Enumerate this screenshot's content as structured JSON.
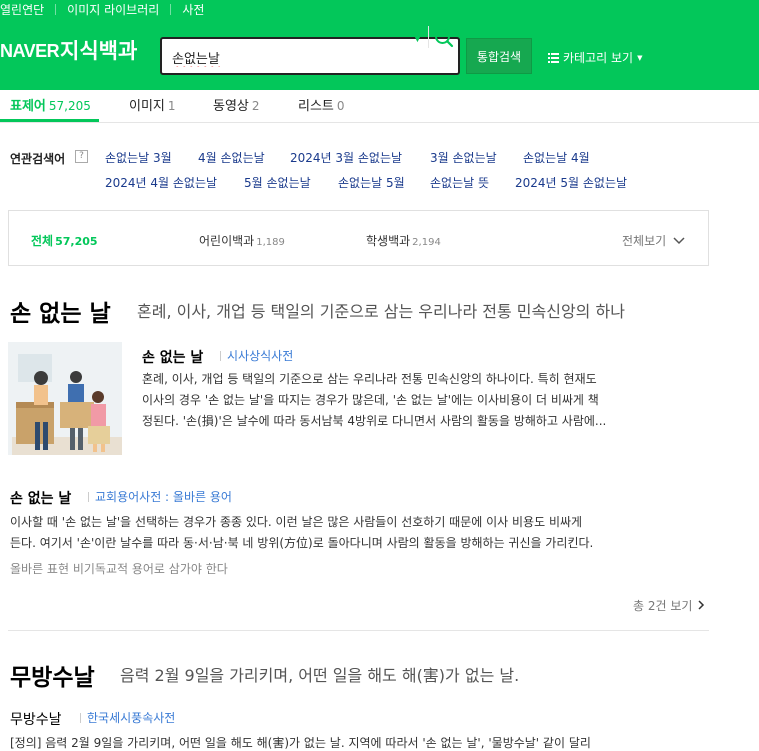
{
  "top_nav": [
    "열린연단",
    "이미지 라이브러리",
    "사전"
  ],
  "header": {
    "logo": "NAVER",
    "service_name": "지식백과",
    "search_value": "손없는날",
    "total_search_label": "통합검색",
    "category_label": "카테고리 보기"
  },
  "tabs": [
    {
      "label": "표제어",
      "count": "57,205"
    },
    {
      "label": "이미지",
      "count": "1"
    },
    {
      "label": "동영상",
      "count": "2"
    },
    {
      "label": "리스트",
      "count": "0"
    }
  ],
  "related": {
    "label": "연관검색어",
    "help": "?",
    "items": [
      "손없는날 3월",
      "4월 손없는날",
      "2024년 3월 손없는날",
      "3월 손없는날",
      "손없는날 4월",
      "2024년 4월 손없는날",
      "5월 손없는날",
      "손없는날 5월",
      "손없는날 뜻",
      "2024년 5월 손없는날"
    ]
  },
  "filter": {
    "items": [
      {
        "label": "전체",
        "count": "57,205"
      },
      {
        "label": "어린이백과",
        "count": "1,189"
      },
      {
        "label": "학생백과",
        "count": "2,194"
      }
    ],
    "view_all": "전체보기"
  },
  "results": [
    {
      "title": "손 없는 날",
      "desc": "혼례, 이사, 개업 등 택일의 기준으로 삼는 우리나라 전통 민속신앙의 하나",
      "entries": [
        {
          "title": "손 없는 날",
          "source": "시사상식사전",
          "body_lines": [
            "혼례, 이사, 개업 등 택일의 기준으로 삼는 우리나라 전통 민속신앙의 하나이다. 특히 현재도",
            "이사의 경우 '손 없는 날'을 따지는 경우가 많은데, '손 없는 날'에는 이사비용이 더 비싸게 책",
            "정된다. '손(損)'은 날수에 따라 동서남북 4방위로 다니면서 사람의 활동을 방해하고 사람에..."
          ]
        },
        {
          "title": "손 없는 날",
          "source": "교회용어사전 : 올바른 용어",
          "body_lines": [
            "이사할 때 '손 없는 날'을 선택하는 경우가 종종 있다. 이런 날은 많은 사람들이 선호하기 때문에 이사 비용도 비싸게",
            "든다. 여기서 '손'이란 날수를 따라 동·서·남·북 네 방위(方位)로 돌아다니며 사람의 활동을 방해하는 귀신을 가리킨다."
          ],
          "extra": "올바른 표현 비기독교적 용어로 삼가야 한다"
        }
      ],
      "more": "총 2건 보기"
    },
    {
      "title": "무방수날",
      "desc": "음력 2월 9일을 가리키며, 어떤 일을 해도 해(害)가 없는 날.",
      "entries": [
        {
          "title": "무방수날",
          "source": "한국세시풍속사전",
          "body_lines": [
            "[정의] 음력 2월 9일을 가리키며, 어떤 일을 해도 해(害)가 없는 날. 지역에 따라서 '손 없는 날', '물방수날' 같이 달리"
          ]
        }
      ]
    }
  ],
  "colors": {
    "brand": "#03c75a",
    "link": "#1a3a8c",
    "source": "#3a7bd5"
  },
  "icons": [
    "search-icon",
    "dropdown-caret-icon",
    "list-icon",
    "chevron-down-icon",
    "chevron-right-icon",
    "help-icon"
  ]
}
